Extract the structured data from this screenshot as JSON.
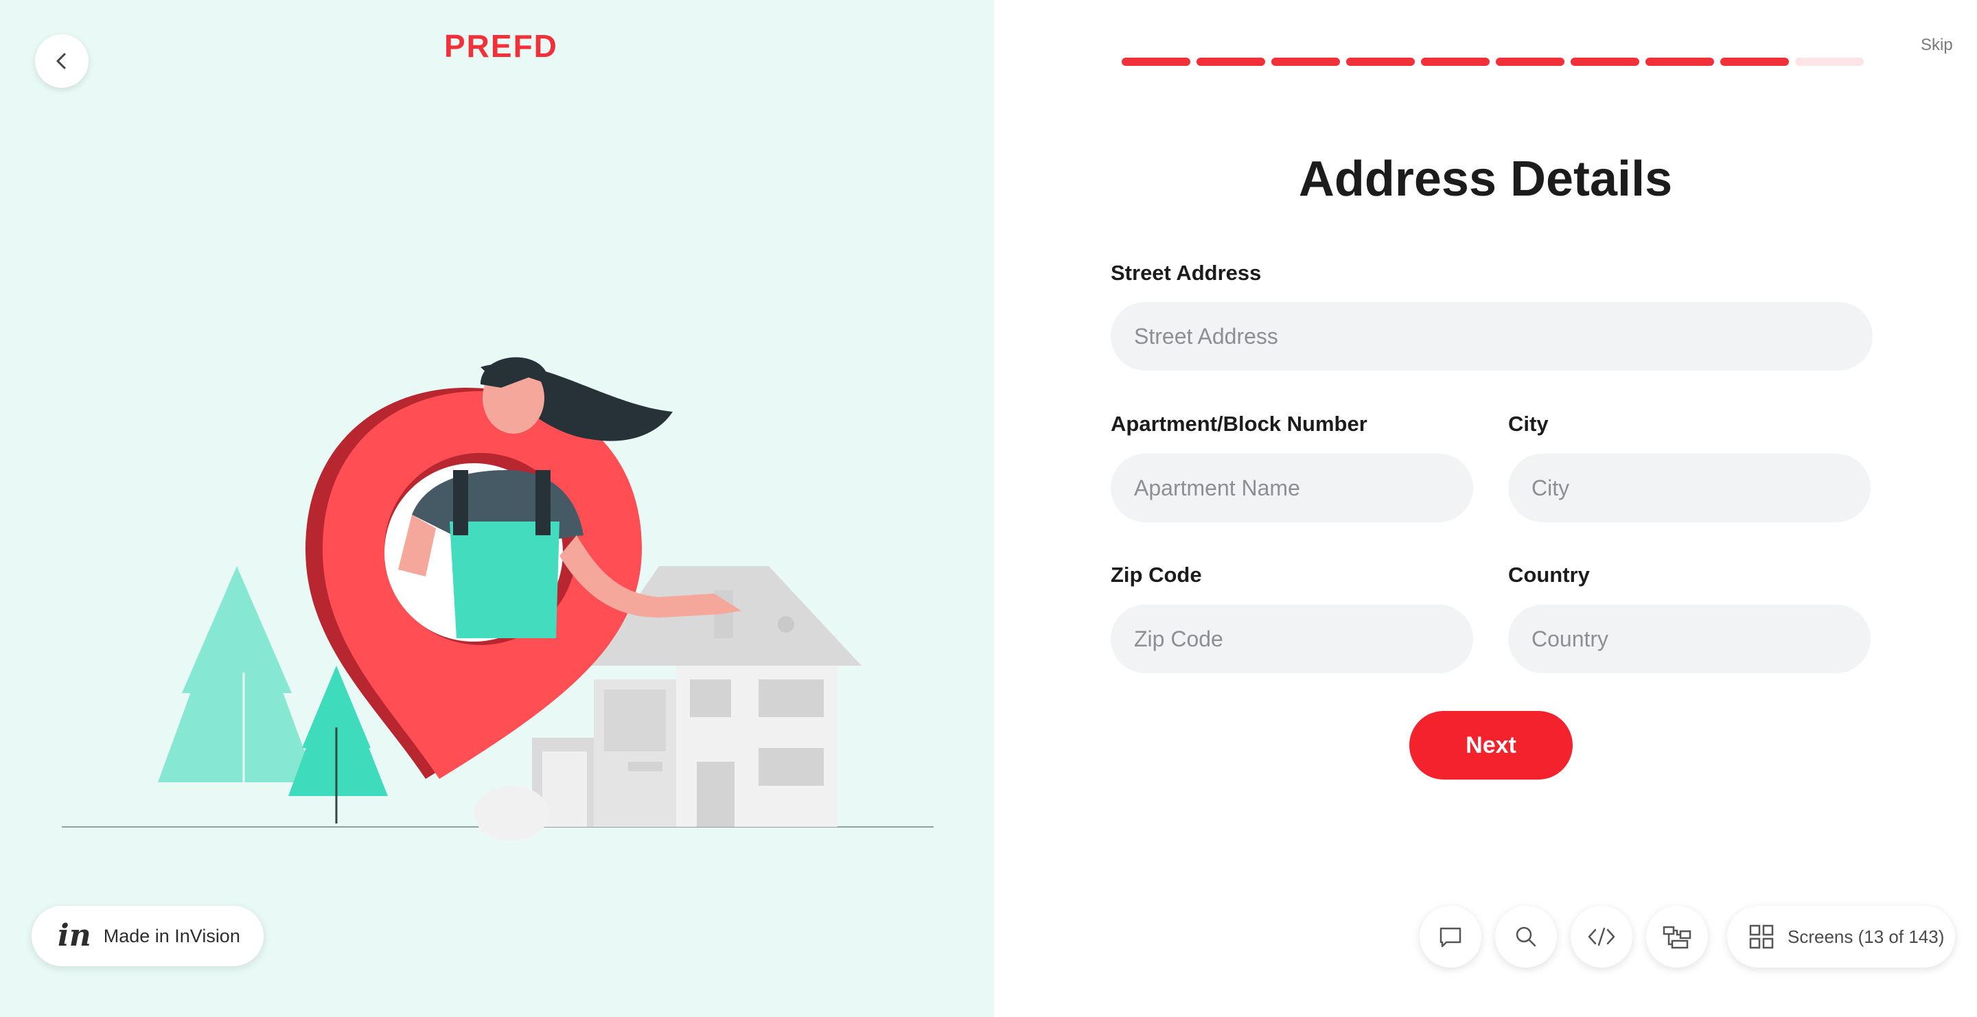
{
  "left": {
    "logo": "PREFD",
    "made_in": "Made in InVision"
  },
  "progress": {
    "total_steps": 10,
    "completed_steps": 9
  },
  "header": {
    "skip_label": "Skip"
  },
  "form": {
    "title": "Address Details",
    "street": {
      "label": "Street Address",
      "placeholder": "Street Address"
    },
    "apartment": {
      "label": "Apartment/Block Number",
      "placeholder": "Apartment Name"
    },
    "city": {
      "label": "City",
      "placeholder": "City"
    },
    "zip": {
      "label": "Zip Code",
      "placeholder": "Zip Code"
    },
    "country": {
      "label": "Country",
      "placeholder": "Country"
    },
    "next_label": "Next"
  },
  "toolbar": {
    "screens_label": "Screens (13 of 143)"
  },
  "colors": {
    "brand_red": "#f2303a",
    "left_bg": "#e9faf6",
    "field_bg": "#f2f3f5"
  },
  "icons": [
    "chevron-left-icon",
    "invision-logo-icon",
    "comment-icon",
    "search-icon",
    "code-icon",
    "flow-icon",
    "screens-grid-icon"
  ]
}
